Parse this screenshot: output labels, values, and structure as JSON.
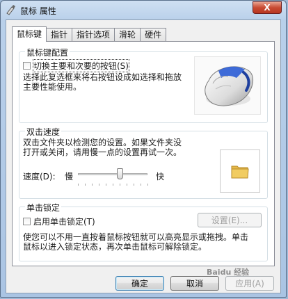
{
  "window": {
    "title": "鼠标 属性",
    "close_label": "X"
  },
  "tabs": [
    {
      "label": "鼠标键",
      "active": true
    },
    {
      "label": "指针",
      "active": false
    },
    {
      "label": "指针选项",
      "active": false
    },
    {
      "label": "滑轮",
      "active": false
    },
    {
      "label": "硬件",
      "active": false
    }
  ],
  "button_config": {
    "title": "鼠标键配置",
    "switch_label": "切换主要和次要的按钮(S)",
    "switch_checked": false,
    "description_line1": "选择此复选框来将右按钮设成如选择和拖放",
    "description_line2": "主要性能使用。"
  },
  "double_click": {
    "title": "双击速度",
    "description_line1": "双击文件夹以检测您的设置。如果文件夹没",
    "description_line2": "打开或关闭，请用慢一点的设置再试一次。",
    "speed_label": "速度(D):",
    "slow_label": "慢",
    "fast_label": "快",
    "speed_value_fraction": 0.6
  },
  "click_lock": {
    "title": "单击锁定",
    "enable_label": "启用单击锁定(T)",
    "enable_checked": false,
    "settings_label": "设置(E)...",
    "description_line1": "使您可以不用一直按着鼠标按钮就可以高亮显示或拖拽。单击",
    "description_line2": "鼠标以进入锁定状态，再次单击鼠标可解除锁定。"
  },
  "footer": {
    "ok_label": "确定",
    "cancel_label": "取消",
    "apply_label": "应用(A)"
  },
  "watermark": "Baidu 经验",
  "icons": {
    "title_icon": "mouse-title-icon",
    "mouse_image": "mouse-illustration",
    "folder": "folder-icon"
  },
  "colors": {
    "accent_blue": "#2f5fd6",
    "folder_yellow": "#f1cc61"
  }
}
